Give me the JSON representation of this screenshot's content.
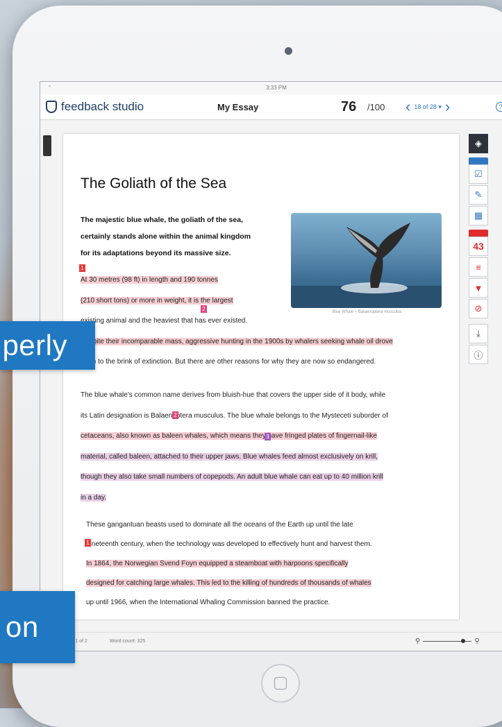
{
  "app": {
    "status_time": "3:33 PM",
    "brand": "feedback studio",
    "doc_title": "My Essay",
    "score": "76",
    "score_max": "/100",
    "pager_text": "18 of 28 ▾",
    "help_symbol": "?"
  },
  "marketing": {
    "badge_top": "perly",
    "badge_bottom": "on"
  },
  "paper": {
    "title": "The Goliath of the Sea",
    "intro": [
      "The majestic blue whale, the goliath of the sea,",
      "certainly stands alone within the animal kingdom",
      "for its adaptations beyond its massive size."
    ],
    "p1": [
      {
        "text": "At 30 metres (98 ft) in length and 190 tonnes",
        "hl": true
      },
      {
        "text": "(210 short tons) or more in weight, it is the largest",
        "hl": true
      },
      {
        "text": "existing animal and the heaviest that has ever existed.",
        "hl": false
      },
      {
        "text": "Despite their incomparable mass, aggressive hunting in the 1900s by whalers seeking whale oil drove",
        "hl": false
      },
      {
        "text": "them to the brink of extinction. But there are other reasons for why they are now so endangered.",
        "hl": false
      }
    ],
    "p2": [
      "The blue whale's common name derives from bluish-hue that covers the upper side of it body, while",
      "its Latin designation is Balaenoptera musculus. The blue whale belongs to the Mysteceti suborder of",
      "cetaceans, also known as baleen whales, which means they have fringed plates of fingernail-like",
      "material, called baleen, attached to their upper jaws. Blue whales feed almost exclusively on krill,",
      "though they also take small numbers of copepods. An adult blue whale can eat up to 40 million krill",
      "in a day."
    ],
    "p3": [
      "These gangantuan beasts used to dominate all the oceans of the Earth up until the late",
      "nineteenth century, when the technology was developed to effectively hunt and harvest them.",
      "In 1864, the Norwegian Svend Foyn equipped a steamboat with harpoons specifically",
      "designed for catching large whales. This led to the killing of hundreds of thousands of whales",
      "up until 1966, when the International Whaling Commission banned the practice."
    ],
    "image_caption": "Blue Whale – Balaenoptera musculus",
    "marks": [
      "1",
      "2",
      "2",
      "3",
      "1"
    ]
  },
  "tools": {
    "grading_count": "43"
  },
  "footer": {
    "page_info": "Page: 1 of 2",
    "word_count": "Word count: 325"
  }
}
